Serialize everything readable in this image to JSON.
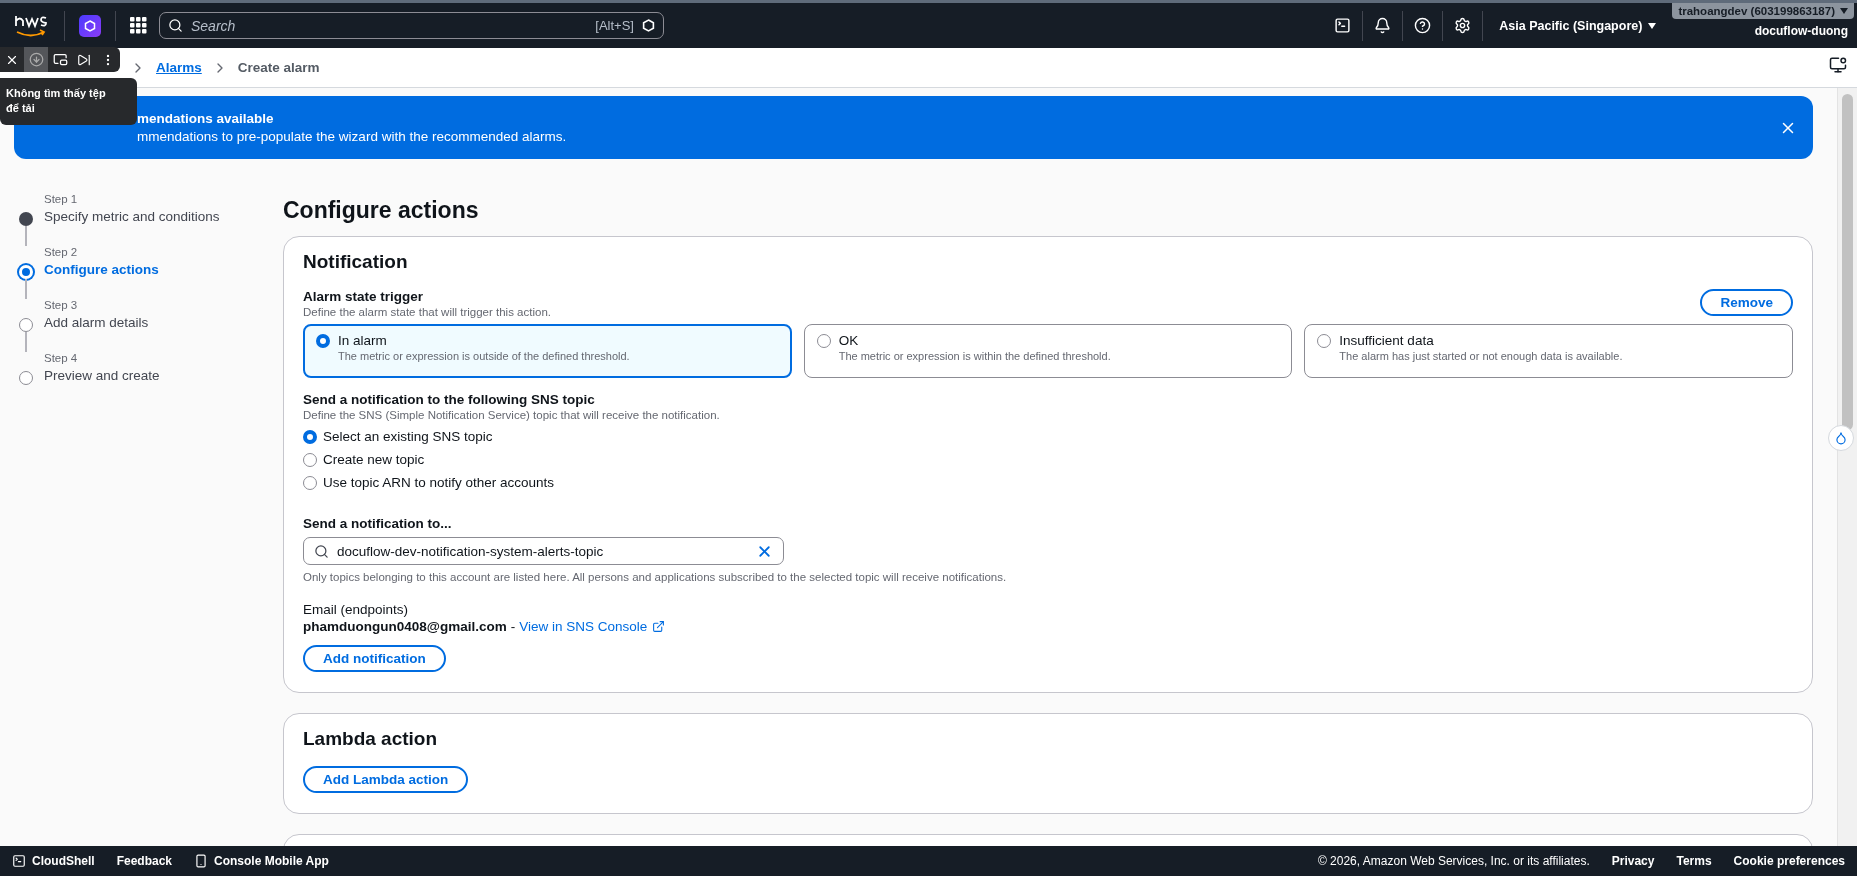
{
  "top_bar": {
    "search_placeholder": "Search",
    "search_shortcut": "[Alt+S]",
    "region": "Asia Pacific (Singapore)",
    "account": "trahoangdev (603199863187)",
    "account_alias": "docuflow-duong"
  },
  "breadcrumbs": [
    {
      "label": "Alarms",
      "kind": "link"
    },
    {
      "label": "Create alarm",
      "kind": "current"
    }
  ],
  "download_popup": {
    "tooltip": "Không tìm thấy tệp để tải"
  },
  "banner": {
    "title": "mendations available",
    "text": "mmendations to pre-populate the wizard with the recommended alarms."
  },
  "steps": [
    {
      "step": "Step 1",
      "title": "Specify metric and conditions",
      "completed": true,
      "selected": false
    },
    {
      "step": "Step 2",
      "title": "Configure actions",
      "completed": false,
      "selected": true
    },
    {
      "step": "Step 3",
      "title": "Add alarm details",
      "completed": false,
      "selected": false
    },
    {
      "step": "Step 4",
      "title": "Preview and create",
      "completed": false,
      "selected": false
    }
  ],
  "page_title": "Configure actions",
  "notification": {
    "title": "Notification",
    "trigger_label": "Alarm state trigger",
    "trigger_hint": "Define the alarm state that will trigger this action.",
    "remove_button": "Remove",
    "triggers": [
      {
        "label": "In alarm",
        "description": "The metric or expression is outside of the defined threshold.",
        "selected": true
      },
      {
        "label": "OK",
        "description": "The metric or expression is within the defined threshold.",
        "selected": false
      },
      {
        "label": "Insufficient data",
        "description": "The alarm has just started or not enough data is available.",
        "selected": false
      }
    ],
    "topic_label": "Send a notification to the following SNS topic",
    "topic_hint": "Define the SNS (Simple Notification Service) topic that will receive the notification.",
    "topic_options": [
      {
        "label": "Select an existing SNS topic",
        "selected": true
      },
      {
        "label": "Create new topic",
        "selected": false
      },
      {
        "label": "Use topic ARN to notify other accounts",
        "selected": false
      }
    ],
    "send_to_label": "Send a notification to...",
    "topic_value": "docuflow-dev-notification-system-alerts-topic",
    "topic_note": "Only topics belonging to this account are listed here. All persons and applications subscribed to the selected topic will receive notifications.",
    "email_label": "Email (endpoints)",
    "email": "phamduongun0408@gmail.com",
    "separator": "-",
    "console_link": "View in SNS Console",
    "add_button": "Add notification"
  },
  "lambda": {
    "title": "Lambda action",
    "add_button": "Add Lambda action"
  },
  "footer": {
    "cloudshell": "CloudShell",
    "feedback": "Feedback",
    "mobile_app": "Console Mobile App",
    "copyright": "© 2026, Amazon Web Services, Inc. or its affiliates.",
    "links": [
      "Privacy",
      "Terms",
      "Cookie preferences"
    ]
  }
}
